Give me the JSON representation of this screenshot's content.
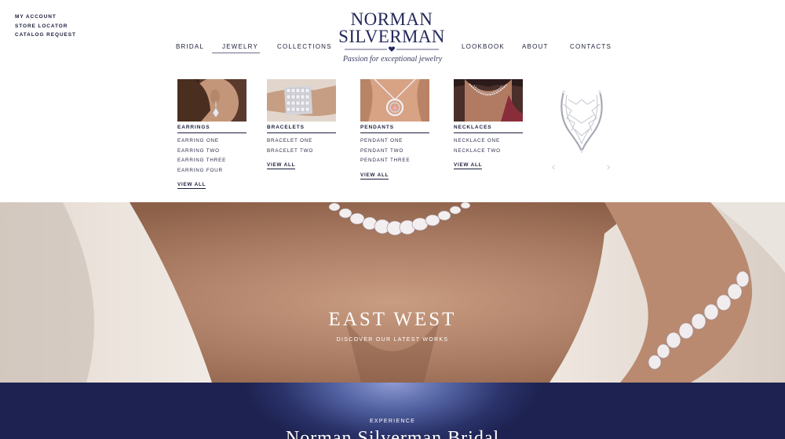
{
  "utility_links": [
    "MY ACCOUNT",
    "STORE LOCATOR",
    "CATALOG REQUEST"
  ],
  "logo": {
    "line1": "NORMAN",
    "line2": "SILVERMAN",
    "tagline": "Passion for exceptional jewelry"
  },
  "nav": {
    "bridal": "BRIDAL",
    "jewelry": "JEWELRY",
    "collections": "COLLECTIONS",
    "lookbook": "LOOKBOOK",
    "about": "ABOUT",
    "contacts": "CONTACTS",
    "active": "JEWELRY"
  },
  "menu": {
    "earrings": {
      "title": "EARRINGS",
      "items": [
        "EARRING ONE",
        "EARRING TWO",
        "EARRING THREE",
        "EARRING FOUR"
      ],
      "view_all": "VIEW ALL"
    },
    "bracelets": {
      "title": "BRACELETS",
      "items": [
        "BRACELET ONE",
        "BRACELET TWO"
      ],
      "view_all": "VIEW ALL"
    },
    "pendants": {
      "title": "PENDANTS",
      "items": [
        "PENDANT ONE",
        "PENDANT TWO",
        "PENDANT THREE"
      ],
      "view_all": "VIEW ALL"
    },
    "necklaces": {
      "title": "NECKLACES",
      "items": [
        "NECKLACE ONE",
        "NECKLACE TWO"
      ],
      "view_all": "VIEW ALL"
    },
    "slider": {
      "prev_icon": "chevron-left-icon",
      "next_icon": "chevron-right-icon"
    }
  },
  "hero": {
    "title": "EAST WEST",
    "subtitle": "DISCOVER OUR LATEST WORKS"
  },
  "banner": {
    "kicker": "EXPERIENCE",
    "title": "Norman Silverman Bridal"
  },
  "colors": {
    "navy": "#1d2250",
    "text": "#1c1f3c",
    "skin": "#ab8068",
    "dress": "#eae0d6"
  }
}
